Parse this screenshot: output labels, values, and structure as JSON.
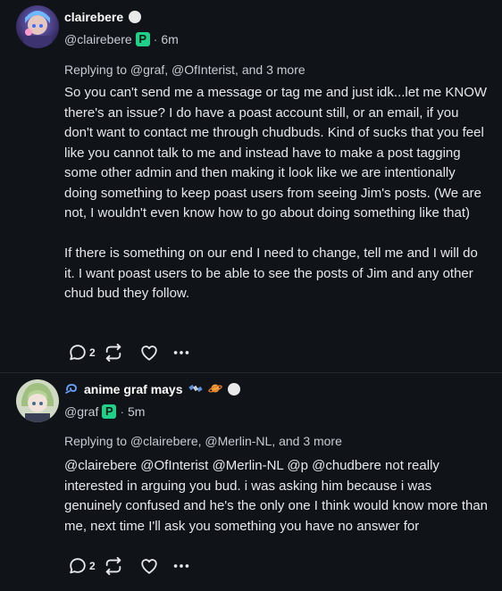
{
  "posts": [
    {
      "display_name": "clairebere",
      "handle": "@clairebere",
      "p_badge": "P",
      "time": "6m",
      "replying_to": "Replying to @graf, @OfInterist, and 3 more",
      "body": "So you can't send me a message or tag me and just idk...let me KNOW there's an issue? I do have a poast account still, or an email, if you don't want to contact me through chudbuds. Kind of sucks that you feel like you cannot talk to me and instead have to make a post tagging some other admin and then making it look like we are intentionally doing something to keep poast users from seeing Jim's posts. (We are not, I wouldn't even know how to go about doing something like that)\n\nIf there is something on our end I need to change, tell me and I will do it. I want poast users to be able to see the posts of Jim and any other chud bud they follow.",
      "reply_count": "2"
    },
    {
      "display_name": "anime graf mays",
      "handle": "@graf",
      "p_badge": "P",
      "time": "5m",
      "replying_to": "Replying to @clairebere, @Merlin-NL, and 3 more",
      "body": "@clairebere @OfInterist @Merlin-NL @p @chudbere not really interested in arguing you bud. i was asking him because i was genuinely confused and he's the only one I think would know more than me, next time I'll ask you something you have no answer for",
      "reply_count": "2"
    }
  ],
  "icons": {
    "reply": "speech-bubble-icon",
    "boost": "repeat-icon",
    "favorite": "heart-icon",
    "more": "ellipsis-icon",
    "verified": "white-dot-badge",
    "p_badge": "poast-p-badge",
    "name_emojis": [
      "satellite-icon",
      "ringed-planet-icon"
    ],
    "name_prefix": "blue-swirl-icon"
  },
  "colors": {
    "background": "#101318",
    "text": "#e6e8ec",
    "p_badge": "#1fd089"
  }
}
